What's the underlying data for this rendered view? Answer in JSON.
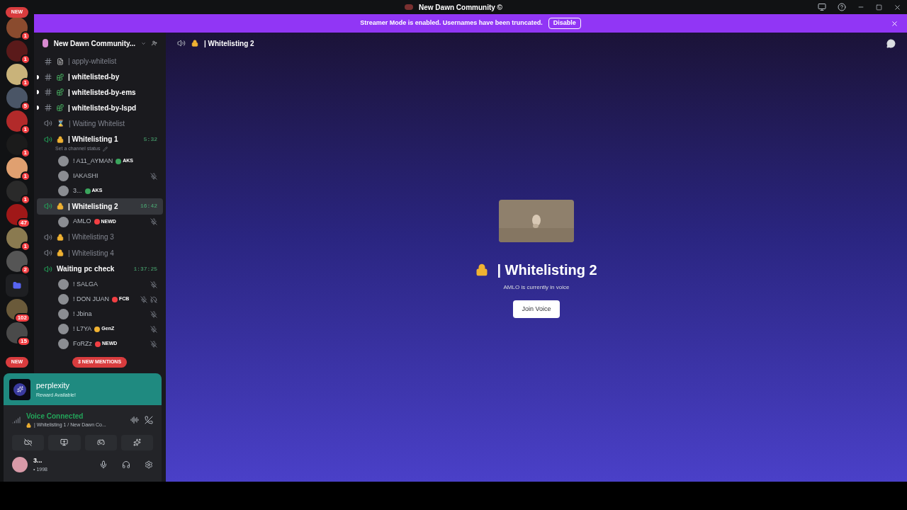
{
  "window": {
    "title": "New Dawn Community ©"
  },
  "banner": {
    "text": "Streamer Mode is enabled. Usernames have been truncated.",
    "button": "Disable"
  },
  "servers": {
    "top_pill": "NEW",
    "bottom_pill": "NEW",
    "items": [
      {
        "kind": "avatar",
        "badge": "1"
      },
      {
        "kind": "avatar",
        "badge": "1"
      },
      {
        "kind": "avatar",
        "badge": "1"
      },
      {
        "kind": "avatar",
        "badge": "5"
      },
      {
        "kind": "avatar",
        "badge": "1"
      },
      {
        "kind": "avatar",
        "badge": "1"
      },
      {
        "kind": "avatar",
        "badge": "1"
      },
      {
        "kind": "avatar",
        "badge": "1"
      },
      {
        "kind": "avatar",
        "badge": "47"
      },
      {
        "kind": "avatar",
        "badge": "1"
      },
      {
        "kind": "avatar",
        "badge": "2"
      },
      {
        "kind": "folder"
      },
      {
        "kind": "avatar",
        "badge": "102"
      },
      {
        "kind": "avatar",
        "badge": "15"
      }
    ]
  },
  "server_header": {
    "name": "New Dawn Community..."
  },
  "channels": [
    {
      "kind": "text",
      "emoji": {
        "kind": "document"
      },
      "name": "| apply-whitelist",
      "unread": false
    },
    {
      "kind": "text",
      "emoji": {
        "kind": "blocks"
      },
      "name": "| whitelisted-by",
      "unread": true
    },
    {
      "kind": "text",
      "emoji": {
        "kind": "blocks"
      },
      "name": "| whitelisted-by-ems",
      "unread": true
    },
    {
      "kind": "text",
      "emoji": {
        "kind": "blocks"
      },
      "name": "| whitelisted-by-lspd",
      "unread": true
    },
    {
      "kind": "voice",
      "emoji": "⌛",
      "name": "| Waiting Whitelist",
      "locked": false,
      "active": false,
      "selected": false
    },
    {
      "kind": "voice",
      "name": "| Whitelisting 1",
      "locked": true,
      "active": true,
      "selected": false,
      "timer": "5:32",
      "status": "Set a channel status",
      "members": [
        {
          "name": "! A11_AYMAN",
          "tag": {
            "text": "AKS",
            "color": "#3ba55d"
          },
          "muted": false
        },
        {
          "name": "IAKASHI",
          "muted": true
        },
        {
          "name": "3...",
          "tag": {
            "text": "AKS",
            "color": "#3ba55d"
          },
          "muted": false
        }
      ]
    },
    {
      "kind": "voice",
      "name": "| Whitelisting 2",
      "locked": true,
      "active": true,
      "selected": true,
      "timer": "16:42",
      "members": [
        {
          "name": "AMLO",
          "tag": {
            "text": "NEWD",
            "color": "#f23f43"
          },
          "muted": true
        }
      ]
    },
    {
      "kind": "voice",
      "name": "| Whitelisting 3",
      "locked": true,
      "active": false,
      "selected": false
    },
    {
      "kind": "voice",
      "name": "| Whitelisting 4",
      "locked": true,
      "active": false,
      "selected": false
    },
    {
      "kind": "voice",
      "name": "Waiting pc check",
      "locked": false,
      "active": true,
      "selected": false,
      "timer": "1:37:25",
      "members": [
        {
          "name": "! SALGA",
          "muted": true
        },
        {
          "name": "! DON JUAN",
          "tag": {
            "text": "FCB",
            "color": "#f23f43"
          },
          "muted": true,
          "deafened": true
        },
        {
          "name": "! Jbina",
          "muted": true
        },
        {
          "name": "! L7YA",
          "tag": {
            "text": "GenZ",
            "color": "#f0b232"
          },
          "muted": true
        },
        {
          "name": "FoRZz",
          "tag": {
            "text": "NEWD",
            "color": "#f23f43"
          },
          "muted": true
        }
      ]
    }
  ],
  "mentions_pill": "3 NEW MENTIONS",
  "promo": {
    "title": "perplexity",
    "subtitle": "Reward Available!"
  },
  "voice_panel": {
    "status": "Voice Connected",
    "channel": "| Whitelisting 1 / New Dawn Co..."
  },
  "user": {
    "name": "3...",
    "status": "• 1998"
  },
  "main": {
    "header": "| Whitelisting 2",
    "title": "| Whitelisting 2",
    "subtitle": "AMLO is currently in voice",
    "button": "Join Voice"
  }
}
